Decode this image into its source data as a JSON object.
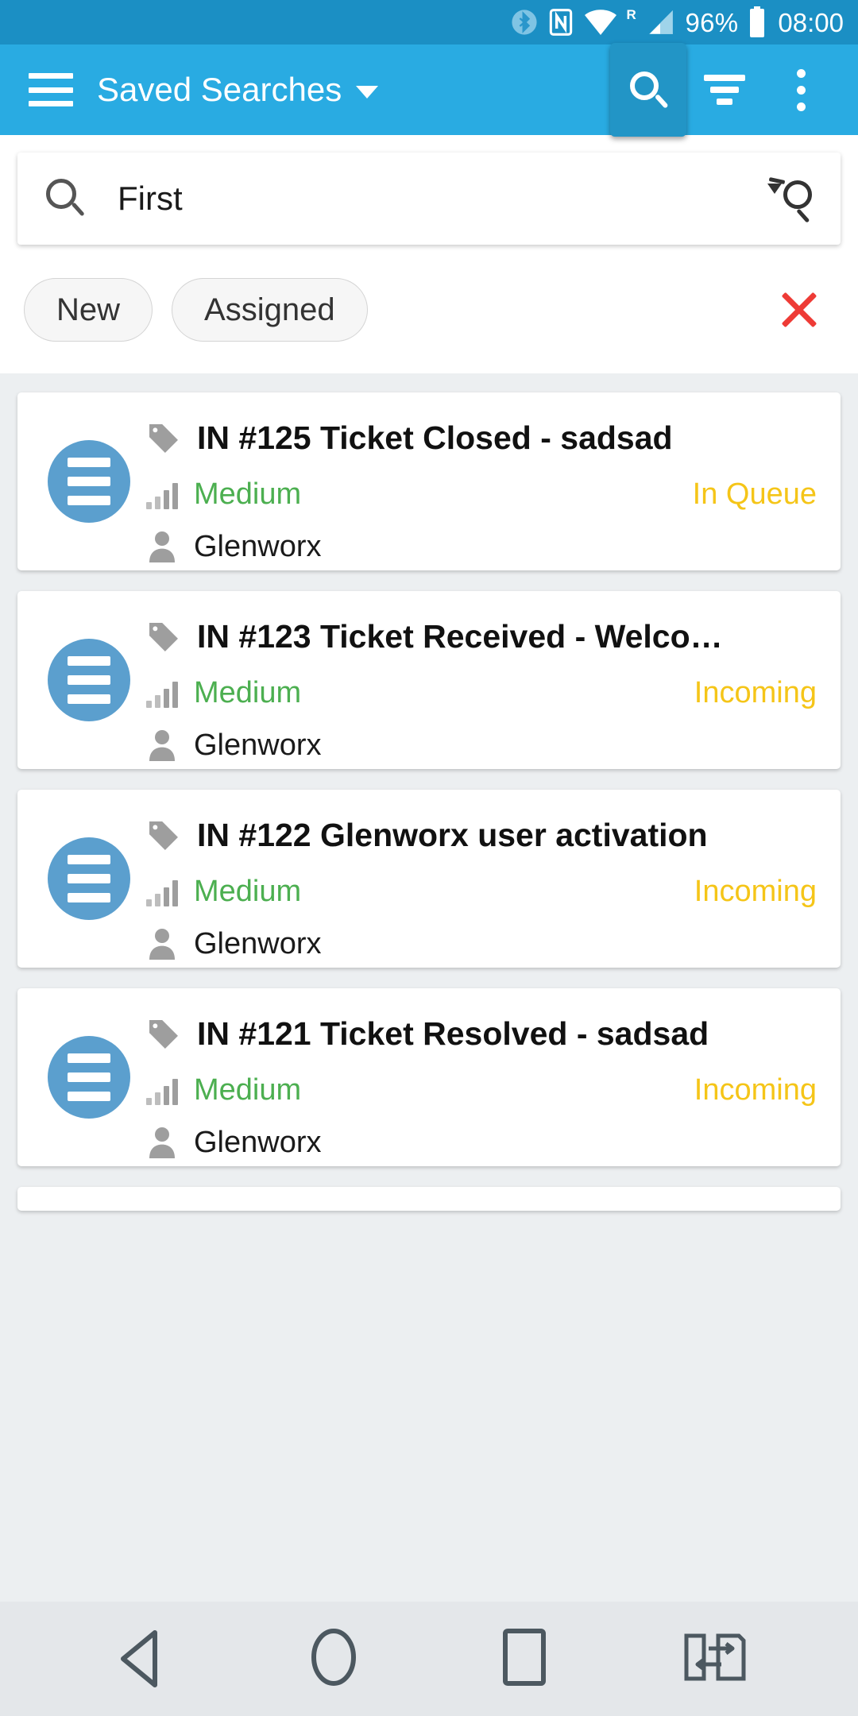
{
  "status_bar": {
    "icons": [
      "bluetooth-icon",
      "nfc-icon",
      "wifi-icon",
      "roaming-icon",
      "cellular-signal-icon"
    ],
    "roaming_label": "R",
    "battery_percent": "96%",
    "clock": "08:00"
  },
  "app_bar": {
    "menu_icon": "hamburger-menu-icon",
    "title": "Saved Searches",
    "dropdown_icon": "chevron-down-icon",
    "actions": [
      {
        "name": "search-icon",
        "label": "Search",
        "active": true
      },
      {
        "name": "filter-icon",
        "label": "Filter",
        "active": false
      },
      {
        "name": "overflow-menu-icon",
        "label": "More options",
        "active": false
      }
    ]
  },
  "search": {
    "leading_icon": "search-icon",
    "value": "First",
    "placeholder": "Search",
    "trailing_icon": "search-again-icon"
  },
  "filters": {
    "chips": [
      {
        "label": "New"
      },
      {
        "label": "Assigned"
      }
    ],
    "clear_icon": "close-icon",
    "clear_color": "#ee3b36"
  },
  "colors": {
    "toolbar": "#29abe2",
    "statusbar": "#1b8fc4",
    "avatar": "#5b9fce",
    "priority": "#4caf50",
    "status": "#f5c518",
    "background": "#eceff1"
  },
  "tickets": [
    {
      "avatar_icon": "list-avatar-icon",
      "tag_icon": "tag-icon",
      "title": "IN #125 Ticket Closed - sadsad",
      "priority_icon": "signal-bars-icon",
      "priority": "Medium",
      "status": "In Queue",
      "person_icon": "person-icon",
      "assignee": "Glenworx"
    },
    {
      "avatar_icon": "list-avatar-icon",
      "tag_icon": "tag-icon",
      "title": "IN #123 Ticket Received - Welco…",
      "priority_icon": "signal-bars-icon",
      "priority": "Medium",
      "status": "Incoming",
      "person_icon": "person-icon",
      "assignee": "Glenworx"
    },
    {
      "avatar_icon": "list-avatar-icon",
      "tag_icon": "tag-icon",
      "title": "IN #122 Glenworx user activation",
      "priority_icon": "signal-bars-icon",
      "priority": "Medium",
      "status": "Incoming",
      "person_icon": "person-icon",
      "assignee": "Glenworx"
    },
    {
      "avatar_icon": "list-avatar-icon",
      "tag_icon": "tag-icon",
      "title": "IN #121 Ticket Resolved - sadsad",
      "priority_icon": "signal-bars-icon",
      "priority": "Medium",
      "status": "Incoming",
      "person_icon": "person-icon",
      "assignee": "Glenworx"
    }
  ],
  "nav_bar": {
    "back": "back-nav-icon",
    "home": "home-nav-icon",
    "recents": "recents-nav-icon",
    "switch": "app-switch-nav-icon"
  }
}
